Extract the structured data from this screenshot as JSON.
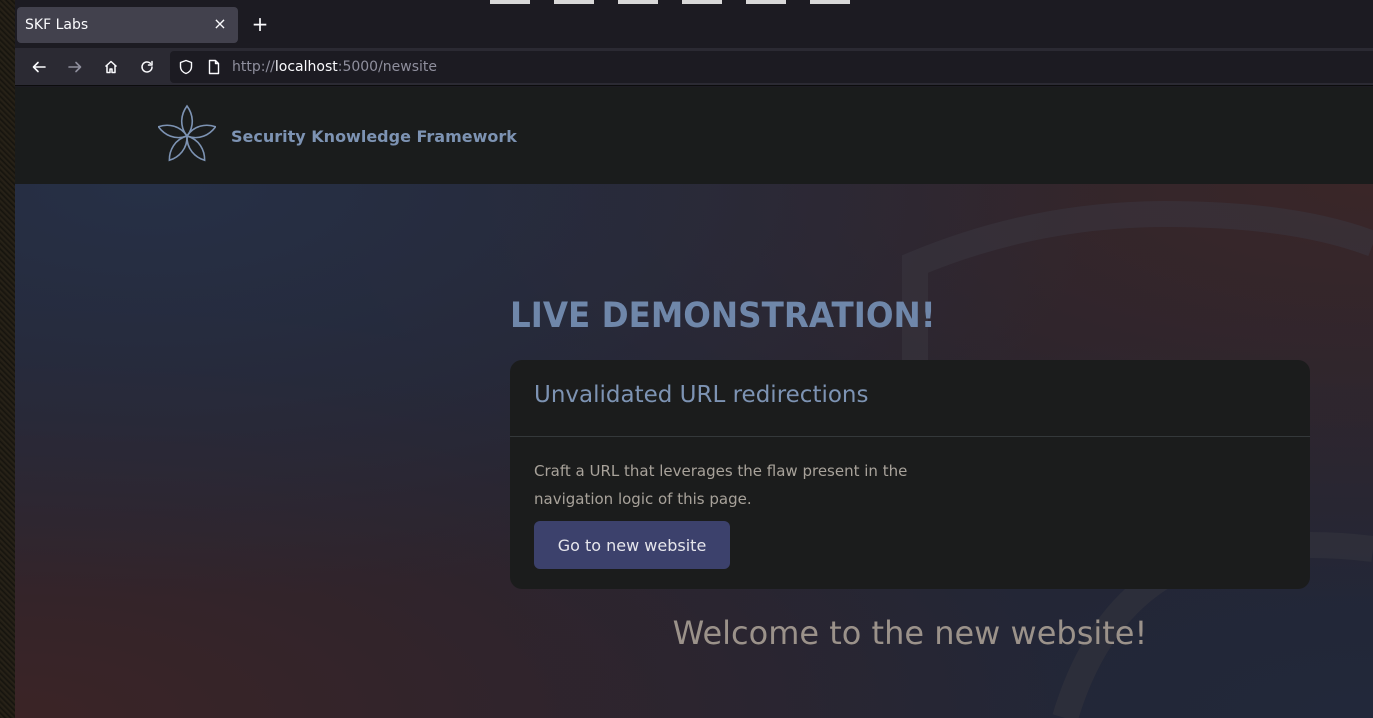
{
  "browser": {
    "tab_title": "SKF Labs",
    "tab_close": "×",
    "new_tab": "+",
    "url_scheme": "http://",
    "url_host": "localhost",
    "url_rest": ":5000/newsite"
  },
  "site": {
    "brand": "Security Knowledge Framework"
  },
  "main": {
    "headline": "LIVE DEMONSTRATION!",
    "card_title": "Unvalidated URL redirections",
    "card_text": "Craft a URL that leverages the flaw present in the navigation logic of this page.",
    "button_label": "Go to new website",
    "welcome": "Welcome to the new website!"
  },
  "colors": {
    "accent": "#7d93b3",
    "button": "#3c416c",
    "header_bg": "#1a1c1c"
  },
  "icons": [
    "back-arrow-icon",
    "forward-arrow-icon",
    "home-icon",
    "reload-icon",
    "shield-icon",
    "page-icon",
    "skf-flower-logo",
    "close-icon",
    "plus-icon"
  ]
}
